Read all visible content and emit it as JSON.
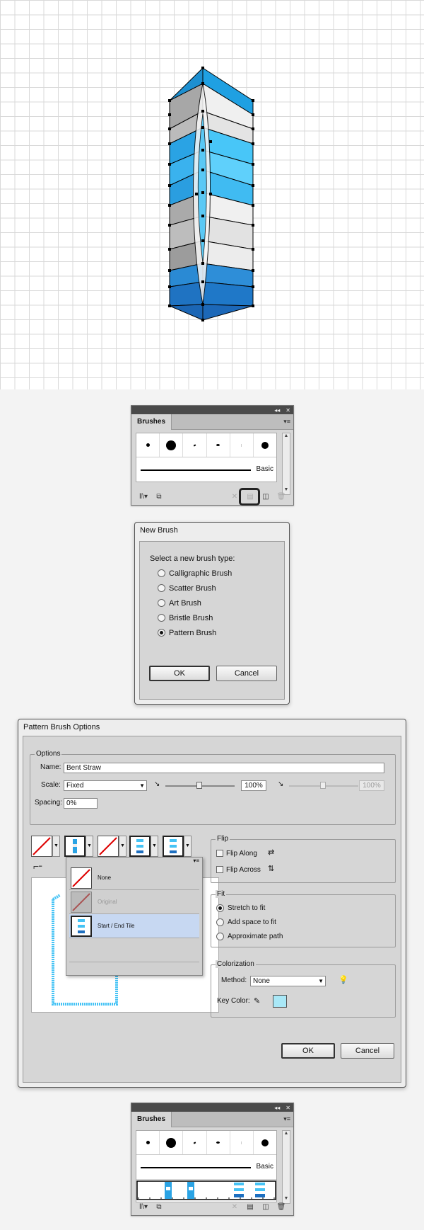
{
  "brushes_panel": {
    "tab": "Brushes",
    "basic_label": "Basic",
    "collapse_glyph": "◂◂",
    "close_glyph": "✕",
    "menu_glyph": "▾≡"
  },
  "new_brush": {
    "title": "New Brush",
    "prompt": "Select a new brush type:",
    "options": [
      "Calligraphic Brush",
      "Scatter Brush",
      "Art Brush",
      "Bristle Brush",
      "Pattern Brush"
    ],
    "selected": "Pattern Brush",
    "ok": "OK",
    "cancel": "Cancel"
  },
  "pattern_options": {
    "title": "Pattern Brush Options",
    "options_group": "Options",
    "name_label": "Name:",
    "name_value": "Bent Straw",
    "scale_label": "Scale:",
    "scale_value": "Fixed",
    "scale_pct": "100%",
    "scale_pct2": "100%",
    "spacing_label": "Spacing:",
    "spacing_value": "0%",
    "tile_menu": {
      "none": "None",
      "original": "Original",
      "start_end": "Start / End Tile"
    },
    "flip_group": "Flip",
    "flip_along": "Flip Along",
    "flip_across": "Flip Across",
    "fit_group": "Fit",
    "fit_options": [
      "Stretch to fit",
      "Add space to fit",
      "Approximate path"
    ],
    "fit_selected": "Stretch to fit",
    "color_group": "Colorization",
    "method_label": "Method:",
    "method_value": "None",
    "keycolor_label": "Key Color:",
    "key_color": "#a9e8f7",
    "ok": "OK",
    "cancel": "Cancel"
  },
  "brushes_panel_2": {
    "tab": "Brushes",
    "basic_label": "Basic",
    "collapse_glyph": "◂◂",
    "close_glyph": "✕",
    "menu_glyph": "▾≡"
  },
  "colors": {
    "blue_dark": "#1d6fc0",
    "blue_mid": "#2a9ee0",
    "blue_light": "#45c3f5",
    "gray": "#aaaaaa",
    "white": "#ececec",
    "selected_row": "#c7d8f2"
  }
}
